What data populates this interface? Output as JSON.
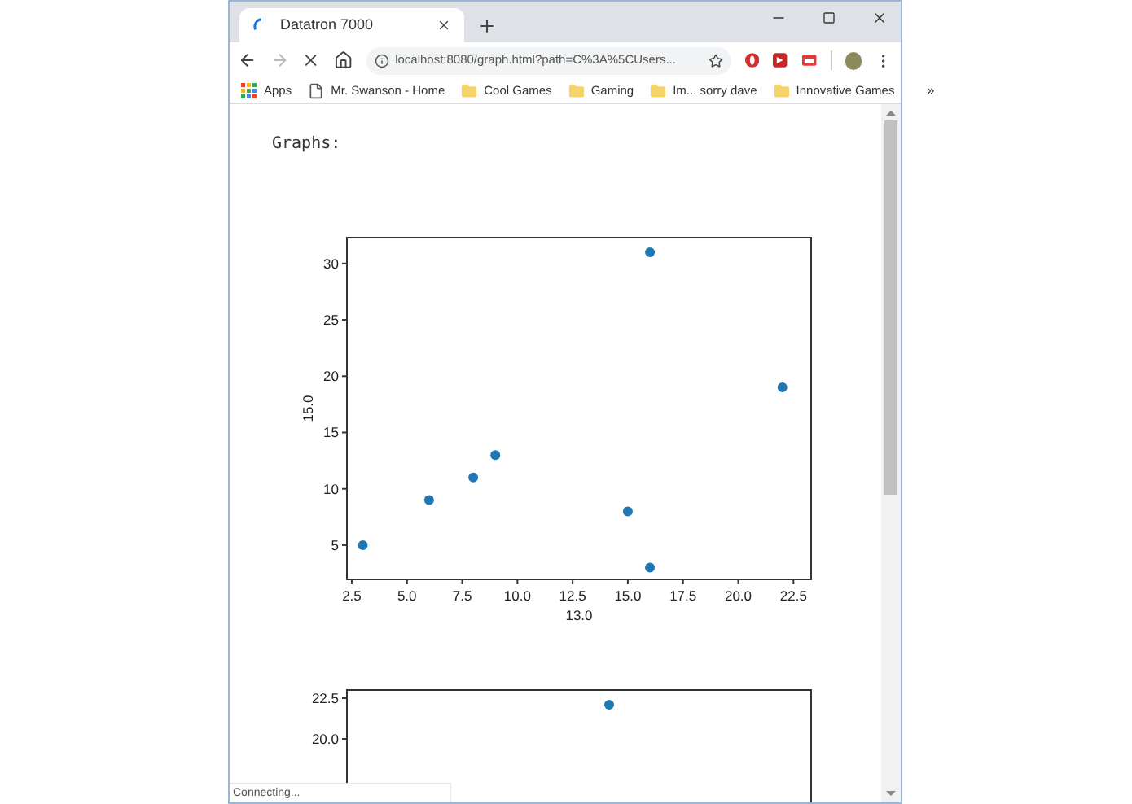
{
  "window": {
    "tab_title": "Datatron 7000",
    "loading": true
  },
  "address_bar": {
    "url": "localhost:8080/graph.html?path=C%3A%5CUsers..."
  },
  "bookmarks": [
    {
      "kind": "apps",
      "label": "Apps"
    },
    {
      "kind": "page",
      "label": "Mr. Swanson - Home"
    },
    {
      "kind": "folder",
      "label": "Cool Games"
    },
    {
      "kind": "folder",
      "label": "Gaming"
    },
    {
      "kind": "folder",
      "label": "Im... sorry dave"
    },
    {
      "kind": "folder",
      "label": "Innovative Games"
    }
  ],
  "bookmarks_overflow": "»",
  "heading": "Graphs:",
  "chart": {
    "chart_data": {
      "type": "scatter",
      "xlabel": "13.0",
      "ylabel": "15.0",
      "xlim": [
        2.28,
        23.3
      ],
      "ylim": [
        1.96,
        32.3
      ],
      "xticks": [
        {
          "value": 2.5,
          "label": "2.5"
        },
        {
          "value": 5,
          "label": "5.0"
        },
        {
          "value": 7.5,
          "label": "7.5"
        },
        {
          "value": 10,
          "label": "10.0"
        },
        {
          "value": 12.5,
          "label": "12.5"
        },
        {
          "value": 15,
          "label": "15.0"
        },
        {
          "value": 17.5,
          "label": "17.5"
        },
        {
          "value": 20,
          "label": "20.0"
        },
        {
          "value": 22.5,
          "label": "22.5"
        }
      ],
      "yticks": [
        5,
        10,
        15,
        20,
        25,
        30
      ],
      "series": [
        {
          "color": "#1f77b4",
          "x": [
            3,
            6,
            8,
            9,
            15,
            16,
            16,
            22
          ],
          "values": [
            5,
            9,
            11,
            13,
            8,
            3,
            31,
            19
          ]
        }
      ]
    }
  },
  "chart_2": {
    "y_tick_labels": [
      "22.5",
      "20.0"
    ]
  },
  "status_bar": "Connecting..."
}
